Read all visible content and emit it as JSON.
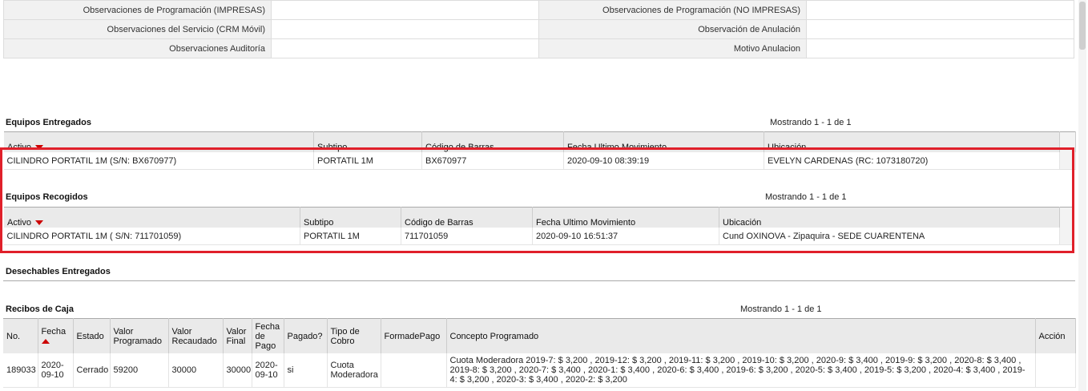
{
  "observations": {
    "rows": [
      {
        "left_label": "Observaciones de Programación (IMPRESAS)",
        "left_value": "",
        "right_label": "Observaciones de Programación (NO IMPRESAS)",
        "right_value": ""
      },
      {
        "left_label": "Observaciones del Servicio (CRM Móvil)",
        "left_value": "",
        "right_label": "Observación de Anulación",
        "right_value": ""
      },
      {
        "left_label": "Observaciones Auditoría",
        "left_value": "",
        "right_label": "Motivo Anulacion",
        "right_value": ""
      }
    ]
  },
  "equipos_entregados": {
    "title": "Equipos Entregados",
    "showing": "Mostrando 1 - 1 de 1",
    "columns": [
      "Activo",
      "Subtipo",
      "Código de Barras",
      "Fecha Ultimo Movimiento",
      "Ubicación"
    ],
    "rows": [
      [
        "CILINDRO PORTATIL 1M (S/N: BX670977)",
        "PORTATIL 1M",
        "BX670977",
        "2020-09-10 08:39:19",
        "EVELYN CARDENAS (RC: 1073180720)"
      ]
    ]
  },
  "equipos_recogidos": {
    "title": "Equipos Recogidos",
    "showing": "Mostrando 1 - 1 de 1",
    "columns": [
      "Activo",
      "Subtipo",
      "Código de Barras",
      "Fecha Ultimo Movimiento",
      "Ubicación"
    ],
    "rows": [
      [
        "CILINDRO PORTATIL 1M ( S/N: 711701059)",
        "PORTATIL 1M",
        "711701059",
        "2020-09-10 16:51:37",
        "Cund OXINOVA - Zipaquira - SEDE CUARENTENA"
      ]
    ]
  },
  "desechables": {
    "title": "Desechables Entregados"
  },
  "recibos": {
    "title": "Recibos de Caja",
    "showing": "Mostrando 1 - 1 de 1",
    "columns": [
      "No.",
      "Fecha",
      "Estado",
      "Valor Programado",
      "Valor Recaudado",
      "Valor Final",
      "Fecha de Pago",
      "Pagado?",
      "Tipo de Cobro",
      "FormadePago",
      "Concepto Programado",
      "Acción"
    ],
    "rows": [
      [
        "189033",
        "2020-09-10",
        "Cerrado",
        "59200",
        "30000",
        "30000",
        "2020-09-10",
        "si",
        "Cuota Moderadora",
        "",
        "Cuota Moderadora 2019-7: $ 3,200 , 2019-12: $ 3,200 , 2019-11: $ 3,200 , 2019-10: $ 3,200 , 2020-9: $ 3,400 , 2019-9: $ 3,200 , 2020-8: $ 3,400 , 2019-8: $ 3,200 , 2020-7: $ 3,400 , 2020-1: $ 3,400 , 2020-6: $ 3,400 , 2019-6: $ 3,200 , 2020-5: $ 3,400 , 2019-5: $ 3,200 , 2020-4: $ 3,400 , 2019-4: $ 3,200 , 2020-3: $ 3,400 , 2020-2: $ 3,200",
        ""
      ]
    ]
  },
  "colors": {
    "highlight": "#e0202a",
    "sort_indicator": "#cc0000",
    "header_bg": "#eaeaea"
  }
}
